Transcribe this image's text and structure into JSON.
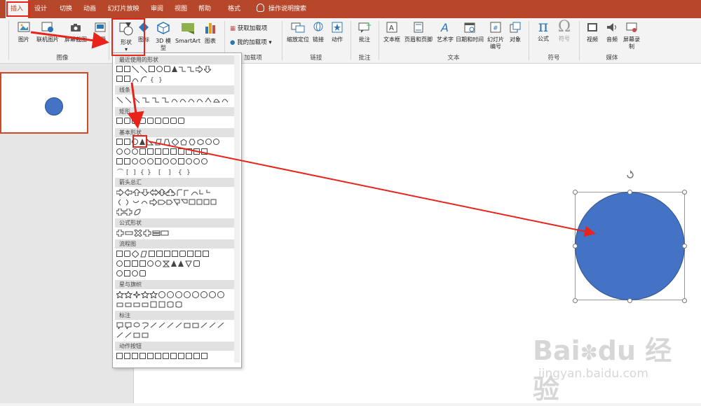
{
  "tabs": [
    "插入",
    "设计",
    "切换",
    "动画",
    "幻灯片放映",
    "审阅",
    "视图",
    "帮助",
    "格式"
  ],
  "active_tab": "插入",
  "tell_me": "操作说明搜索",
  "ribbon": {
    "images_group": {
      "label": "图像",
      "picture": "图片",
      "online_picture": "联机图片",
      "screenshot": "屏幕截图",
      "album": "相册"
    },
    "illustrations": {
      "shapes": "形状",
      "icons": "图标",
      "model3d": "3D 模型",
      "smartart": "SmartArt",
      "chart": "图表"
    },
    "addins_group": {
      "label": "加载项",
      "get": "获取加载项",
      "my": "我的加载项"
    },
    "links_group": {
      "label": "链接",
      "zoom": "缩放定位",
      "link": "链接",
      "action": "动作"
    },
    "comments_group": {
      "label": "批注",
      "comment": "批注"
    },
    "text_group": {
      "label": "文本",
      "textbox": "文本框",
      "header_footer": "页眉和页脚",
      "wordart": "艺术字",
      "datetime": "日期和时间",
      "slide_number": "幻灯片编号",
      "object": "对象"
    },
    "symbols_group": {
      "label": "符号",
      "equation": "公式",
      "symbol": "符号"
    },
    "media_group": {
      "label": "媒体",
      "video": "视频",
      "audio": "音频",
      "record": "屏幕录制"
    }
  },
  "shape_menu": {
    "categories": [
      "最近使用的形状",
      "线条",
      "矩形",
      "基本形状",
      "箭头总汇",
      "公式形状",
      "流程图",
      "星与旗帜",
      "标注",
      "动作按钮"
    ]
  },
  "watermark": {
    "brand": "Bai",
    "brand2": "du",
    "brand_cn": "经验",
    "url": "jingyan.baidu.com"
  },
  "colors": {
    "accent": "#b7472a",
    "highlight": "#e8231a",
    "shape_fill": "#4472c4"
  }
}
